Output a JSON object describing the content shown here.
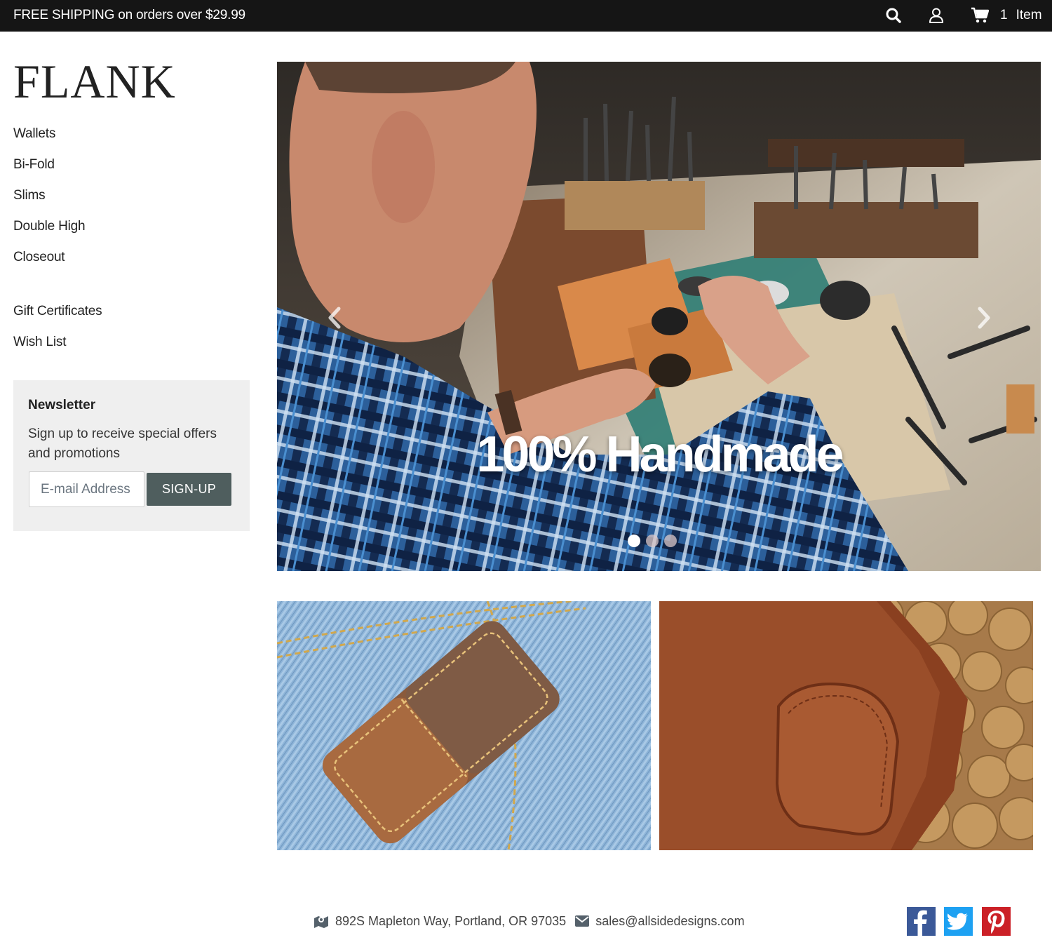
{
  "topbar": {
    "promo_text": "FREE SHIPPING on orders over $29.99",
    "search_icon": "search-icon",
    "account_icon": "user-icon",
    "cart_icon": "cart-icon",
    "cart_count": "1",
    "cart_label": "Item"
  },
  "brand": {
    "logo": "FLANK"
  },
  "sidebar": {
    "categories": [
      "Wallets",
      "Bi-Fold",
      "Slims",
      "Double High",
      "Closeout"
    ],
    "links": [
      "Gift Certificates",
      "Wish List"
    ]
  },
  "newsletter": {
    "title": "Newsletter",
    "description": "Sign up to receive special offers and promotions",
    "email_placeholder": "E-mail Address",
    "button_label": "SIGN-UP"
  },
  "hero": {
    "caption": "100% Handmade",
    "slide_count": 3,
    "active_slide": 1,
    "prev_icon": "chevron-left-icon",
    "next_icon": "chevron-right-icon"
  },
  "promos": [
    {
      "image": "wallet-in-jeans-pocket-photo"
    },
    {
      "image": "leather-wallet-on-coins-photo"
    }
  ],
  "footer": {
    "address": "892S Mapleton Way, Portland, OR 97035",
    "email": "sales@allsidedesigns.com",
    "address_icon": "map-icon",
    "email_icon": "envelope-icon",
    "social": [
      "facebook-icon",
      "twitter-icon",
      "pinterest-icon"
    ]
  },
  "colors": {
    "topbar_bg": "#151515",
    "newsletter_bg": "#efefef",
    "button_bg": "#4f5e5e",
    "facebook": "#3b5998",
    "twitter": "#1da1f2",
    "pinterest": "#cb2027"
  }
}
